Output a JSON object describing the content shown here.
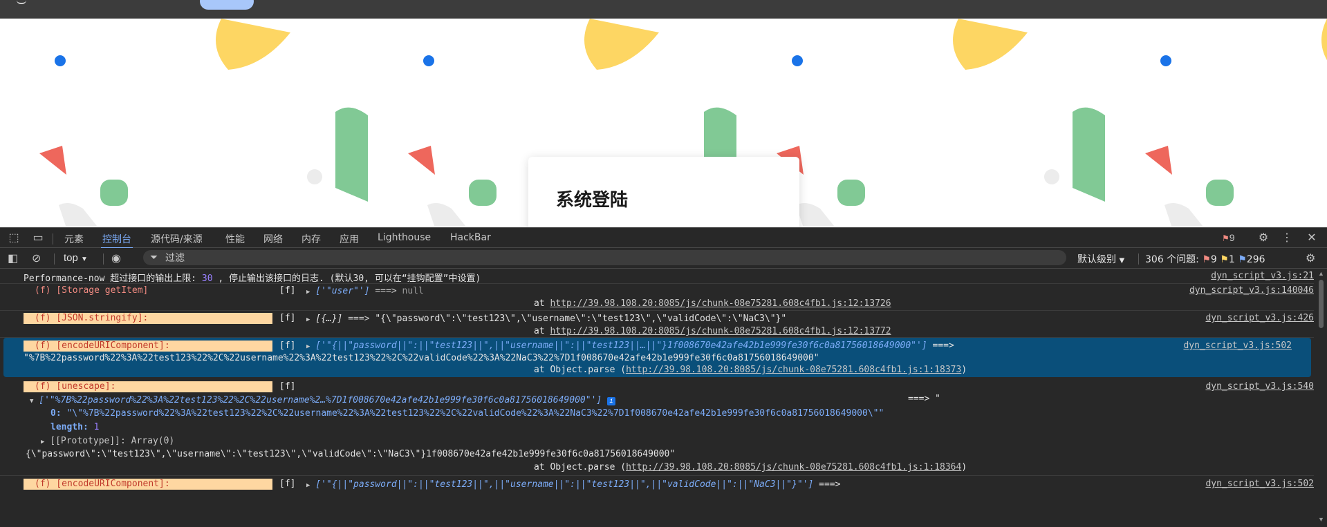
{
  "page": {
    "login_title": "系统登陆"
  },
  "colors": {
    "accent": "#7cacf8",
    "selected_row": "#0a4f7a",
    "badge_bg": "#fed7a1",
    "error": "#f28b82",
    "warning": "#fdd663"
  },
  "devtools": {
    "tabs": [
      "元素",
      "控制台",
      "源代码/来源",
      "性能",
      "网络",
      "内存",
      "应用",
      "Lighthouse",
      "HackBar"
    ],
    "active_tab": "控制台",
    "error_count": "9",
    "toolbar": {
      "context": "top",
      "filter_placeholder": "过滤",
      "level": "默认级别",
      "issues_label": "306 个问题:",
      "issues_errors": "9",
      "issues_warnings": "1",
      "issues_info": "296"
    },
    "console": {
      "r0": {
        "prefix": "Performance-now 超过接口的输出上限: ",
        "limit": "30",
        "suffix": " , 停止输出该接口的日志. (默认30, 可以在“挂钩配置”中设置)",
        "source": "dyn_script_v3.js:21"
      },
      "r1": {
        "badge": "(f) [Storage getItem]",
        "bracket": "[f]",
        "args": "['\"user\"']",
        "arrow": " ===> ",
        "result": "null",
        "at": "at ",
        "url": "http://39.98.108.20:8085/js/chunk-08e75281.608c4fb1.js:12:13726",
        "source": "dyn_script_v3.js:140046"
      },
      "r2": {
        "badge": "(f) [JSON.stringify]:",
        "bracket": "[f]",
        "args": "[{…}]",
        "arrow": " ===> ",
        "result": "\"{\\\"password\\\":\\\"test123\\\",\\\"username\\\":\\\"test123\\\",\\\"validCode\\\":\\\"NaC3\\\"}\"",
        "at": "at ",
        "url": "http://39.98.108.20:8085/js/chunk-08e75281.608c4fb1.js:12:13772",
        "source": "dyn_script_v3.js:426"
      },
      "r3": {
        "badge": "(f) [encodeURIComponent]:",
        "bracket": "[f]",
        "args": "['\"{||\"password||\":||\"test123||\",||\"username||\":||\"test123||…||\"}1f008670e42afe42b1e999fe30f6c0a81756018649000\"']",
        "arrow": " ===> ",
        "result": "\"%7B%22password%22%3A%22test123%22%2C%22username%22%3A%22test123%22%2C%22validCode%22%3A%22NaC3%22%7D1f008670e42afe42b1e999fe30f6c0a81756018649000\"",
        "at": "at Object.parse (",
        "url": "http://39.98.108.20:8085/js/chunk-08e75281.608c4fb1.js:1:18373",
        "close": ")",
        "source": "dyn_script_v3.js:502"
      },
      "r4": {
        "badge": "(f) [unescape]:",
        "bracket": "[f]",
        "args": "['\"%7B%22password%22%3A%22test123%22%2C%22username%2…%7D1f008670e42afe42b1e999fe30f6c0a81756018649000\"']",
        "info": "i",
        "arrow": "===> \"",
        "item0_key": "0:",
        "item0_val": " \"\\\"%7B%22password%22%3A%22test123%22%2C%22username%22%3A%22test123%22%2C%22validCode%22%3A%22NaC3%22%7D1f008670e42afe42b1e999fe30f6c0a81756018649000\\\"\"",
        "length_key": "length:",
        "length_val": " 1",
        "proto": "[[Prototype]]: Array(0)",
        "result": "{\\\"password\\\":\\\"test123\\\",\\\"username\\\":\\\"test123\\\",\\\"validCode\\\":\\\"NaC3\\\"}1f008670e42afe42b1e999fe30f6c0a81756018649000\"",
        "at": "at Object.parse (",
        "url": "http://39.98.108.20:8085/js/chunk-08e75281.608c4fb1.js:1:18364",
        "close": ")",
        "source": "dyn_script_v3.js:540"
      },
      "r5": {
        "badge": "(f) [encodeURIComponent]:",
        "bracket": "[f]",
        "args": "['\"{||\"password||\":||\"test123||\",||\"username||\":||\"test123||\",||\"validCode||\":||\"NaC3||\"}\"']",
        "arrow": " ===>",
        "source": "dyn_script_v3.js:502"
      }
    }
  }
}
